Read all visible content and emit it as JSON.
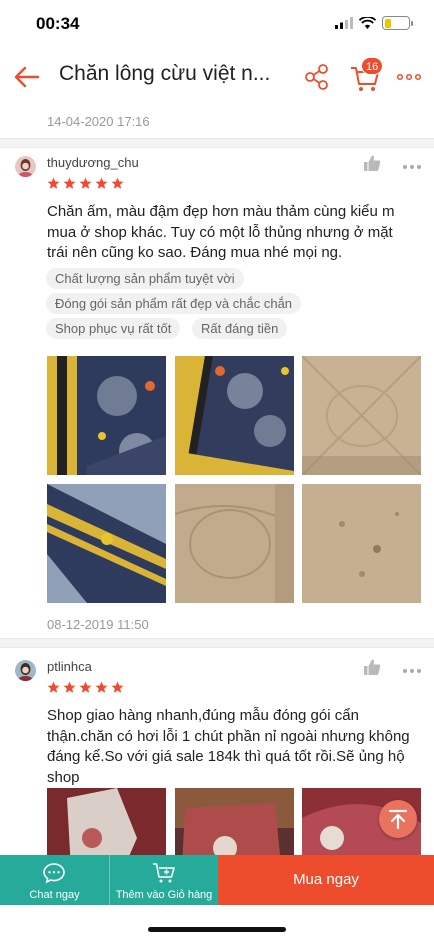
{
  "status_bar": {
    "time": "00:34",
    "battery_level": 0.3
  },
  "header": {
    "title": "Chăn lông cừu việt n...",
    "cart_count": "16",
    "accent_color": "#ee4d2d"
  },
  "previous_review": {
    "date": "14-04-2020 17:16"
  },
  "reviews": [
    {
      "username": "thuydương_chu",
      "rating": 5,
      "text": "Chăn ấm, màu đậm đẹp hơn màu thảm cùng kiểu m mua ở shop khác. Tuy có một lỗ thủng nhưng ở mặt trái nên cũng ko sao. Đáng mua nhé mọi ng.",
      "tags": [
        "Chất lượng sản phẩm tuyệt vời",
        "Đóng gói sản phẩm rất đẹp và chắc chắn",
        "Shop phục vụ rất tốt",
        "Rất đáng tiền"
      ],
      "photo_count": 6,
      "date": "08-12-2019 11:50"
    },
    {
      "username": "ptlinhca",
      "rating": 5,
      "text": "Shop giao hàng nhanh,đúng mẫu đóng gói cẩn thận.chăn có hơi lỗi 1 chút phần nỉ ngoài nhưng không đáng kể.So với giá sale 184k thì quá tốt rồi.Sẽ ủng hộ shop",
      "photo_count": 3
    }
  ],
  "bottom_bar": {
    "chat_label": "Chat ngay",
    "add_to_cart_label": "Thêm vào Giỏ hàng",
    "buy_label": "Mua ngay"
  },
  "icons": [
    "back-arrow-icon",
    "share-icon",
    "cart-icon",
    "more-icon",
    "like-icon",
    "star-icon",
    "chat-icon",
    "add-to-cart-icon",
    "scroll-top-icon"
  ]
}
